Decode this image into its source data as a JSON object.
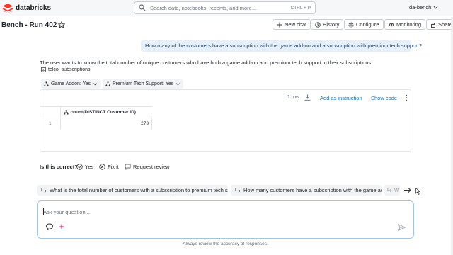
{
  "app": {
    "brand": "databricks",
    "user": "da-bench"
  },
  "search": {
    "placeholder": "Search data, notebooks, recents, and more...",
    "shortcut": "CTRL + P"
  },
  "page": {
    "title": "Bench - Run 402"
  },
  "toolbar": {
    "new_chat": "New chat",
    "history": "History",
    "configure": "Configure",
    "monitoring": "Monitoring",
    "share": "Share"
  },
  "conversation": {
    "user_message": "How many of the customers have a subscription with the game add-on and a subscription with premium tech support?",
    "answer": "The user wants to know the total number of unique customers who have both a game add-on and premium tech support in their subscriptions.",
    "table_ref": "telco_subscriptions",
    "filters": [
      {
        "label": "Game Addon: Yes"
      },
      {
        "label": "Premium Tech Support: Yes"
      }
    ]
  },
  "result": {
    "row_count": "1 row",
    "add_instruction": "Add as instruction",
    "show_code": "Show code",
    "columns": [
      "count(DISTINCT Customer ID)"
    ],
    "rows": [
      {
        "index": "1",
        "value": "273"
      }
    ]
  },
  "feedback": {
    "label": "Is this correct?",
    "yes": "Yes",
    "fix": "Fix it",
    "review": "Request review"
  },
  "suggestions": [
    "What is the total number of customers with a subscription to premium tech support?",
    "How many customers have a subscription with the game add-on?",
    "W"
  ],
  "composer": {
    "placeholder": "Ask your question..."
  },
  "disclaimer": "Always review the accuracy of responses.",
  "colors": {
    "accent": "#2272b4",
    "message_bg": "#e6f0fa",
    "brand": "#ff3621"
  }
}
